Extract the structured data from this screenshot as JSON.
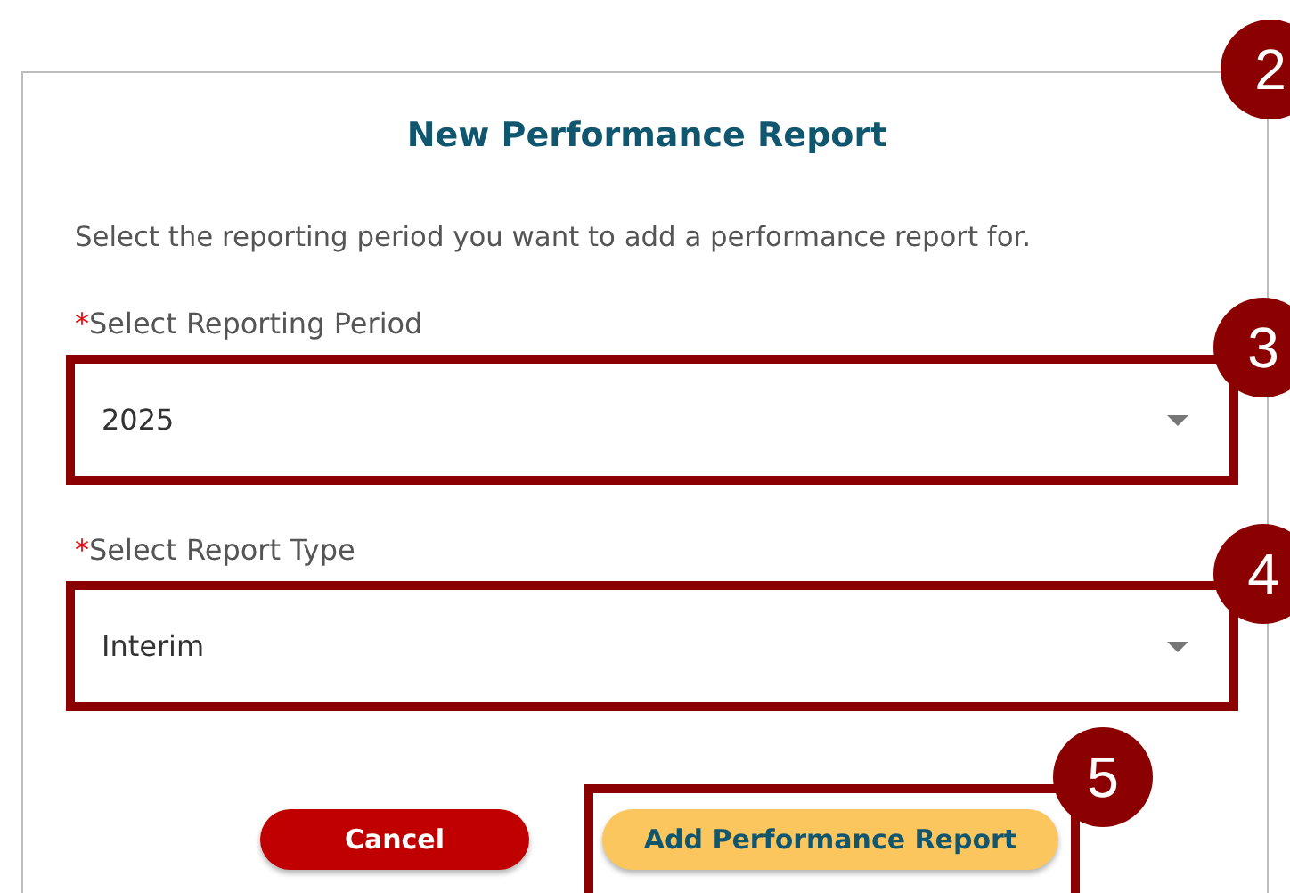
{
  "dialog": {
    "title": "New Performance Report",
    "callout": "2",
    "description": "Select the reporting period you want to add a performance report for.",
    "fields": [
      {
        "required_mark": "*",
        "label": "Select Reporting Period",
        "value": "2025",
        "callout": "3"
      },
      {
        "required_mark": "*",
        "label": "Select Report Type",
        "value": "Interim",
        "callout": "4"
      }
    ],
    "buttons": [
      {
        "label": "Cancel",
        "kind": "danger"
      },
      {
        "label": "Add Performance Report",
        "kind": "primary",
        "callout": "5"
      }
    ]
  }
}
